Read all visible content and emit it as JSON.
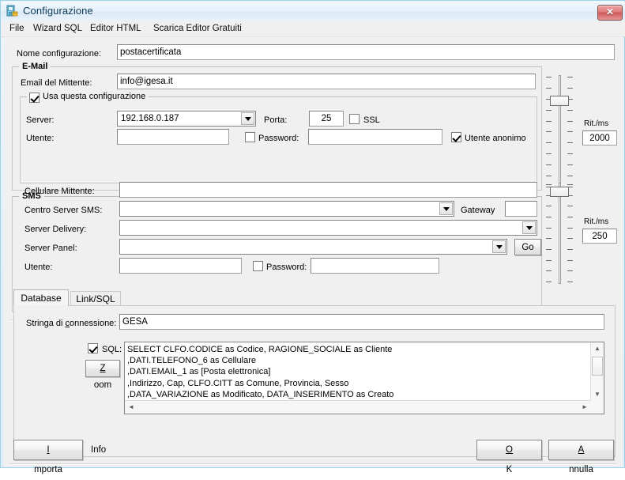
{
  "window": {
    "title": "Configurazione",
    "icon": "config-app-icon",
    "close_label": "✕"
  },
  "menubar": {
    "items": [
      {
        "label": "File"
      },
      {
        "label": "Wizard SQL"
      },
      {
        "label": "Editor HTML"
      },
      {
        "label": "Scarica Editor Gratuiti"
      }
    ]
  },
  "config_name": {
    "label": "Nome configurazione:",
    "value": "postacertificata",
    "placeholder": ""
  },
  "email": {
    "group_title": "E-Mail",
    "sender_label": "Email del Mittente:",
    "sender_value": "info@igesa.it",
    "use_config_label": "Usa questa configurazione",
    "use_config_checked": true,
    "server_label": "Server:",
    "server_value": "192.168.0.187",
    "porta_label": "Porta:",
    "porta_value": "25",
    "ssl_label": "SSL",
    "ssl_checked": false,
    "utente_label": "Utente:",
    "utente_value": "",
    "password_label": "Password:",
    "password_checked": false,
    "password_value": "",
    "anonymous_label": "Utente anonimo",
    "anonymous_checked": true,
    "delay_label": "Rit./ms",
    "delay_value": "2000",
    "slider_position_pct": 20
  },
  "sms": {
    "group_title": "SMS",
    "cellulare_label": "Cellulare Mittente:",
    "cellulare_value": "",
    "centro_label": "Centro Server SMS:",
    "centro_value": "",
    "gateway_label": "Gateway",
    "gateway_value": "",
    "delivery_label": "Server Delivery:",
    "delivery_value": "",
    "panel_label": "Server Panel:",
    "panel_value": "",
    "go_label": "Go",
    "utente_label": "Utente:",
    "utente_value": "",
    "password_label": "Password:",
    "password_checked": false,
    "password_value": "",
    "delay_label": "Rit./ms",
    "delay_value": "250",
    "slider_position_pct": 4
  },
  "tabs": [
    {
      "label": "Database",
      "active": true
    },
    {
      "label": "Link/SQL",
      "active": false
    }
  ],
  "database": {
    "conn_label_pre": "Stringa di ",
    "conn_label_accel": "c",
    "conn_label_post": "onnessione:",
    "conn_label_full": "Stringa di connessione:",
    "conn_value": "GESA",
    "sql_checkbox_label": "SQL:",
    "sql_checked": true,
    "zoom_button_label_accel": "Z",
    "zoom_button_label_rest": "oom",
    "zoom_button_label_full": "Zoom",
    "sql_text": "SELECT CLFO.CODICE as Codice, RAGIONE_SOCIALE as Cliente\n,DATI.TELEFONO_6 as Cellulare\n,DATI.EMAIL_1 as [Posta elettronica]\n,Indirizzo, Cap, CLFO.CITT as Comune, Provincia, Sesso\n,DATA_VARIAZIONE as Modificato, DATA_INSERIMENTO as Creato",
    "scroll_up_icon": "▲",
    "scroll_down_icon": "▼",
    "scroll_left_icon": "◄",
    "scroll_right_icon": "►"
  },
  "footer": {
    "importa_accel": "I",
    "importa_rest": "mporta",
    "importa_full": "Importa",
    "info_label": "Info",
    "ok_accel": "O",
    "ok_rest": "K",
    "ok_full": "OK",
    "annulla_accel": "A",
    "annulla_rest": "nnulla",
    "annulla_full": "Annulla"
  },
  "colors": {
    "window_border": "#9fd2e6",
    "titlebar_text": "#0d3b59",
    "close_red": "#cf5757",
    "client_bg": "#f0f0f0",
    "field_bg": "#ffffff",
    "field_border": "#848484"
  }
}
